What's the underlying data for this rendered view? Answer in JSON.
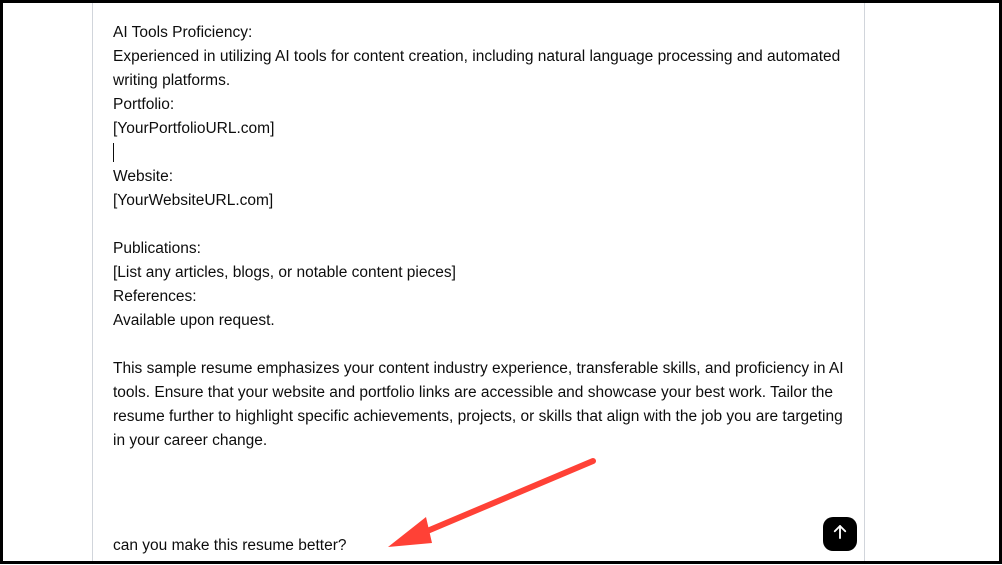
{
  "message": {
    "lines": [
      "AI Tools Proficiency:",
      "Experienced in utilizing AI tools for content creation, including natural language processing and automated writing platforms.",
      "Portfolio:",
      "[YourPortfolioURL.com]"
    ],
    "website_header": "Website:",
    "website_value": "[YourWebsiteURL.com]",
    "publications_header": "Publications:",
    "publications_value": "[List any articles, blogs, or notable content pieces]",
    "references_header": "References:",
    "references_value": "Available upon request.",
    "closing": "This sample resume emphasizes your content industry experience, transferable skills, and proficiency in AI tools. Ensure that your website and portfolio links are accessible and showcase your best work. Tailor the resume further to highlight specific achievements, projects, or skills that align with the job you are targeting in your career change."
  },
  "user_prompt": "can you make this resume better?"
}
